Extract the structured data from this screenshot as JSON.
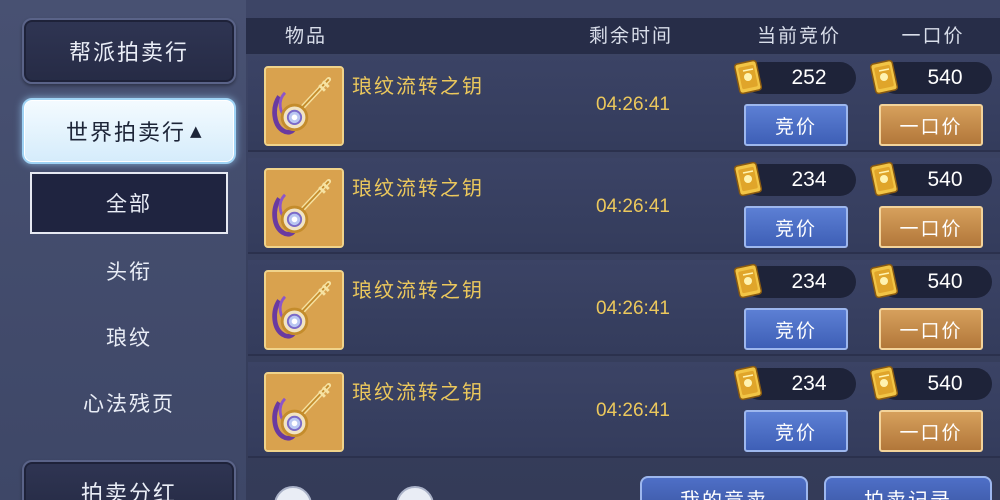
{
  "sidebar": {
    "guild_auction": "帮派拍卖行",
    "world_auction": "世界拍卖行",
    "expand_symbol": "▲",
    "categories": [
      "全部",
      "头衔",
      "琅纹",
      "心法残页"
    ],
    "dividend": "拍卖分红"
  },
  "header": {
    "item": "物品",
    "remaining_time": "剩余时间",
    "current_bid": "当前竞价",
    "buyout": "一口价"
  },
  "listings": [
    {
      "name": "琅纹流转之钥",
      "time": "04:26:41",
      "current_bid": "252",
      "buyout": "540",
      "bid_label": "竞价",
      "buyout_label": "一口价"
    },
    {
      "name": "琅纹流转之钥",
      "time": "04:26:41",
      "current_bid": "234",
      "buyout": "540",
      "bid_label": "竞价",
      "buyout_label": "一口价"
    },
    {
      "name": "琅纹流转之钥",
      "time": "04:26:41",
      "current_bid": "234",
      "buyout": "540",
      "bid_label": "竞价",
      "buyout_label": "一口价"
    },
    {
      "name": "琅纹流转之钥",
      "time": "04:26:41",
      "current_bid": "234",
      "buyout": "540",
      "bid_label": "竞价",
      "buyout_label": "一口价"
    }
  ],
  "bottom": {
    "my_bids": "我的竞卖",
    "auction_log": "拍卖记录"
  },
  "colors": {
    "gold_text": "#ecc85c",
    "bid_button": "#4a6cc4",
    "buyout_button": "#c48a48"
  },
  "icons": {
    "item": "golden-key-icon",
    "currency": "gold-ingot-scroll-icon"
  }
}
